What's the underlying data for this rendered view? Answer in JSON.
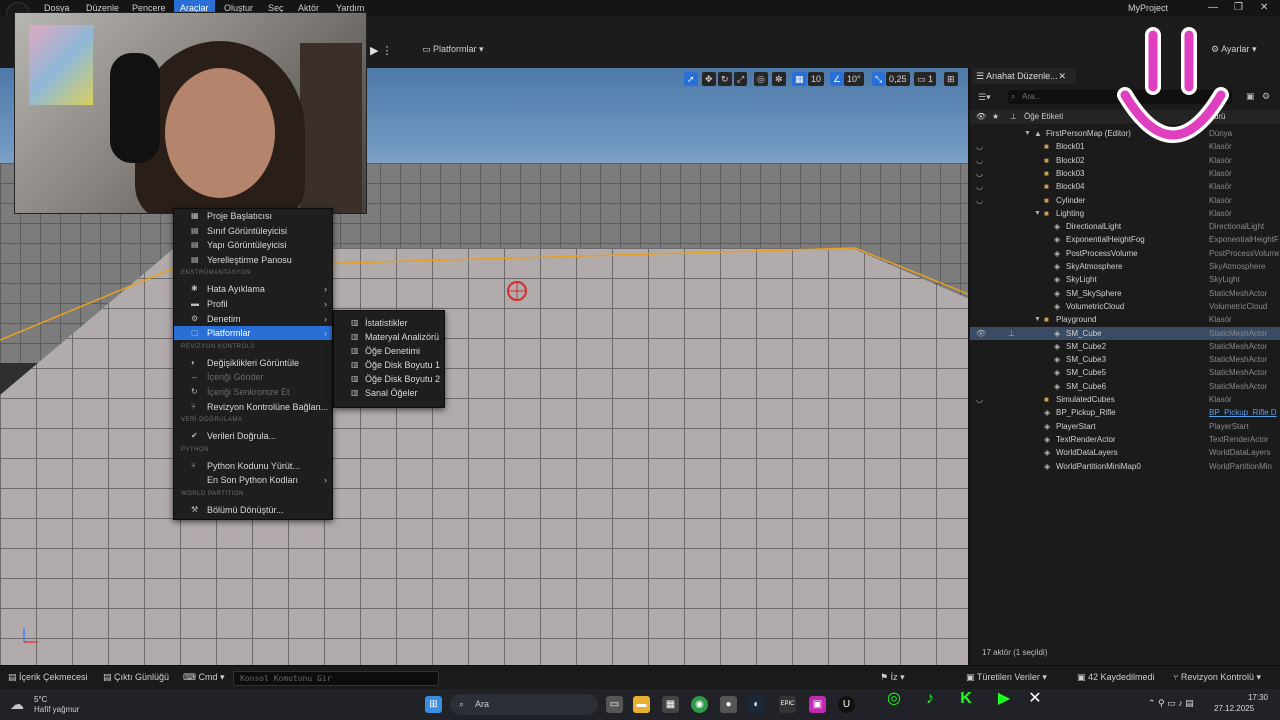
{
  "menubar": {
    "items": [
      "Dosya",
      "Düzenle",
      "Pencere",
      "Araçlar",
      "Oluştur",
      "Seç",
      "Aktör",
      "Yardım"
    ],
    "active": "Araçlar",
    "project": "MyProject"
  },
  "toolbar": {
    "platforms_label": "Platformlar",
    "settings_label": "Ayarlar"
  },
  "viewport": {
    "grid_value": "10",
    "angle_value": "10°",
    "scale_value": "0,25",
    "camera_speed": "1"
  },
  "tools_menu": {
    "items": [
      {
        "type": "item",
        "icon": "▦",
        "label": "Proje Başlatıcısı"
      },
      {
        "type": "item",
        "icon": "▤",
        "label": "Sınıf Görüntüleyicisi"
      },
      {
        "type": "item",
        "icon": "▤",
        "label": "Yapı Görüntüleyicisi"
      },
      {
        "type": "item",
        "icon": "▤",
        "label": "Yerelleştirme Panosu"
      },
      {
        "type": "section",
        "label": "ENSTRÜMANTASYON"
      },
      {
        "type": "item",
        "icon": "✱",
        "label": "Hata Ayıklama",
        "submenu": true
      },
      {
        "type": "item",
        "icon": "▬",
        "label": "Profil",
        "submenu": true
      },
      {
        "type": "item",
        "icon": "⚙",
        "label": "Denetim",
        "submenu": true
      },
      {
        "type": "item",
        "icon": "▢",
        "label": "Platformlar",
        "submenu": true,
        "highlight": true
      },
      {
        "type": "section",
        "label": "REVİZYON KONTROLÜ"
      },
      {
        "type": "item",
        "icon": "◐",
        "label": "Değişiklikleri Görüntüle"
      },
      {
        "type": "item",
        "icon": "←",
        "label": "İçeriği Gönder",
        "disabled": true
      },
      {
        "type": "item",
        "icon": "↻",
        "label": "İçeriği Senkronize Et",
        "disabled": true
      },
      {
        "type": "item",
        "icon": "⑂",
        "label": "Revizyon Kontrolüne Bağlan..."
      },
      {
        "type": "section",
        "label": "VERİ DOĞRULAMA"
      },
      {
        "type": "item",
        "icon": "✔",
        "label": "Verileri Doğrula..."
      },
      {
        "type": "section",
        "label": "PYTHON"
      },
      {
        "type": "item",
        "icon": "⑂",
        "label": "Python Kodunu Yürüt..."
      },
      {
        "type": "item",
        "icon": "",
        "label": "En Son Python Kodları",
        "submenu": true
      },
      {
        "type": "section",
        "label": "WORLD PARTITION"
      },
      {
        "type": "item",
        "icon": "⚒",
        "label": "Bölümü Dönüştür..."
      }
    ]
  },
  "submenu": {
    "items": [
      "İstatistikler",
      "Materyal Analizörü",
      "Öğe Denetimi",
      "Öğe Disk Boyutu 1",
      "Öğe Disk Boyutu 2",
      "Sanal Öğeler"
    ]
  },
  "outliner": {
    "tab": "Anahat Düzenle...",
    "search_placeholder": "Ara...",
    "col_label": "Öğe Etiketi",
    "col_type": "Türü",
    "rows": [
      {
        "level": 0,
        "kind": "map",
        "name": "FirstPersonMap (Editor)",
        "type": "Dünya",
        "eye": false,
        "expand": "▼"
      },
      {
        "level": 1,
        "kind": "folder",
        "name": "Block01",
        "type": "Klasör",
        "eye": true
      },
      {
        "level": 1,
        "kind": "folder",
        "name": "Block02",
        "type": "Klasör",
        "eye": true
      },
      {
        "level": 1,
        "kind": "folder",
        "name": "Block03",
        "type": "Klasör",
        "eye": true
      },
      {
        "level": 1,
        "kind": "folder",
        "name": "Block04",
        "type": "Klasör",
        "eye": true
      },
      {
        "level": 1,
        "kind": "folder",
        "name": "Cylinder",
        "type": "Klasör",
        "eye": true
      },
      {
        "level": 1,
        "kind": "folder",
        "name": "Lighting",
        "type": "Klasör",
        "eye": false,
        "expand": "▼"
      },
      {
        "level": 2,
        "kind": "actor",
        "name": "DirectionalLight",
        "type": "DirectionalLight",
        "eye": false
      },
      {
        "level": 2,
        "kind": "actor",
        "name": "ExponentialHeightFog",
        "type": "ExponentialHeightFog",
        "eye": false
      },
      {
        "level": 2,
        "kind": "actor",
        "name": "PostProcessVolume",
        "type": "PostProcessVolume",
        "eye": false
      },
      {
        "level": 2,
        "kind": "actor",
        "name": "SkyAtmosphere",
        "type": "SkyAtmosphere",
        "eye": false
      },
      {
        "level": 2,
        "kind": "actor",
        "name": "SkyLight",
        "type": "SkyLight",
        "eye": false
      },
      {
        "level": 2,
        "kind": "actor",
        "name": "SM_SkySphere",
        "type": "StaticMeshActor",
        "eye": false
      },
      {
        "level": 2,
        "kind": "actor",
        "name": "VolumetricCloud",
        "type": "VolumetricCloud",
        "eye": false
      },
      {
        "level": 1,
        "kind": "folder",
        "name": "Playground",
        "type": "Klasör",
        "eye": false,
        "expand": "▼"
      },
      {
        "level": 2,
        "kind": "actor",
        "name": "SM_Cube",
        "type": "StaticMeshActor",
        "eye": true,
        "selected": true
      },
      {
        "level": 2,
        "kind": "actor",
        "name": "SM_Cube2",
        "type": "StaticMeshActor",
        "eye": false
      },
      {
        "level": 2,
        "kind": "actor",
        "name": "SM_Cube3",
        "type": "StaticMeshActor",
        "eye": false
      },
      {
        "level": 2,
        "kind": "actor",
        "name": "SM_Cube5",
        "type": "StaticMeshActor",
        "eye": false
      },
      {
        "level": 2,
        "kind": "actor",
        "name": "SM_Cube6",
        "type": "StaticMeshActor",
        "eye": false
      },
      {
        "level": 1,
        "kind": "folder",
        "name": "SimulatedCubes",
        "type": "Klasör",
        "eye": true
      },
      {
        "level": 1,
        "kind": "actor",
        "name": "BP_Pickup_Rifle",
        "type": "BP_Pickup_Rifle D",
        "eye": false,
        "link": true
      },
      {
        "level": 1,
        "kind": "actor",
        "name": "PlayerStart",
        "type": "PlayerStart",
        "eye": false
      },
      {
        "level": 1,
        "kind": "actor",
        "name": "TextRenderActor",
        "type": "TextRenderActor",
        "eye": false
      },
      {
        "level": 1,
        "kind": "actor",
        "name": "WorldDataLayers",
        "type": "WorldDataLayers",
        "eye": false
      },
      {
        "level": 1,
        "kind": "actor",
        "name": "WorldPartitionMiniMap0",
        "type": "WorldPartitionMin",
        "eye": false
      }
    ],
    "status": "17 aktör (1 seçildi)"
  },
  "bottombar": {
    "content_drawer": "İçerik Çekmecesi",
    "output_log": "Çıktı Günlüğü",
    "cmd": "Cmd",
    "console_placeholder": "Konsol Komutunu Gir",
    "derived": "Türetilen Veriler",
    "saved": "42 Kaydedilmedi",
    "revision": "Revizyon Kontrolü",
    "trace": "İz"
  },
  "taskbar": {
    "temperature": "5°C",
    "weather": "Hafif yağmur",
    "search": "Ara",
    "time": "17:30",
    "date": "27.12.2025"
  },
  "colors": {
    "accent": "#2a6fd6",
    "selection": "#3a4c64",
    "overlay_pink": "#e040c0"
  }
}
